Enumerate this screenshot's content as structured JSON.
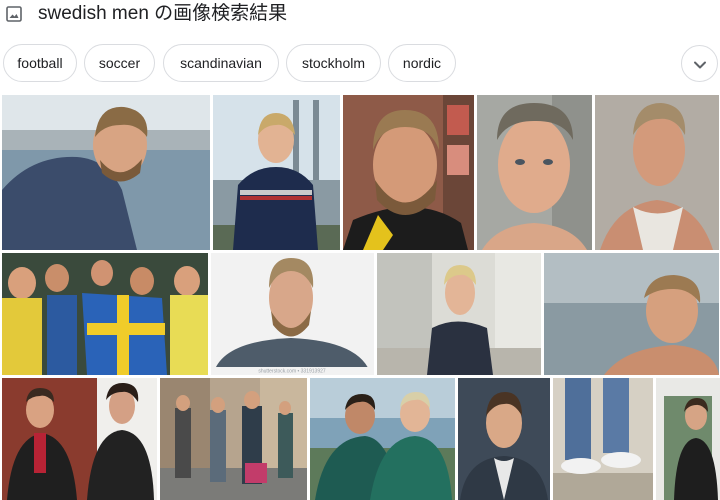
{
  "header": {
    "title": "swedish men の画像検索結果",
    "icon": "image-icon"
  },
  "chips": [
    {
      "label": "football"
    },
    {
      "label": "soccer"
    },
    {
      "label": "scandinavian"
    },
    {
      "label": "stockholm"
    },
    {
      "label": "nordic"
    }
  ],
  "chips_expand_icon": "chevron-down-icon",
  "results": [
    {
      "subject": "man in blue shirt by harbor"
    },
    {
      "subject": "young man in striped navy sweater"
    },
    {
      "subject": "bearded man in yellow jersey"
    },
    {
      "subject": "close-up portrait of young man"
    },
    {
      "subject": "man in tank top"
    },
    {
      "subject": "crowd of fans with flags"
    },
    {
      "subject": "bearded man in gray t-shirt",
      "watermark": "shutterstock.com • 331913927"
    },
    {
      "subject": "blond man in denim jacket"
    },
    {
      "subject": "man by the sea"
    },
    {
      "subject": "two men against brick wall"
    },
    {
      "subject": "street scene with people"
    },
    {
      "subject": "two footballers embracing"
    },
    {
      "subject": "man in blazer portrait"
    },
    {
      "subject": "legs in jeans and white sneakers"
    },
    {
      "subject": "man in dark coat by door"
    }
  ],
  "colors": {
    "chip_border": "#dadce0",
    "text": "#202124",
    "icon": "#5f6368"
  }
}
